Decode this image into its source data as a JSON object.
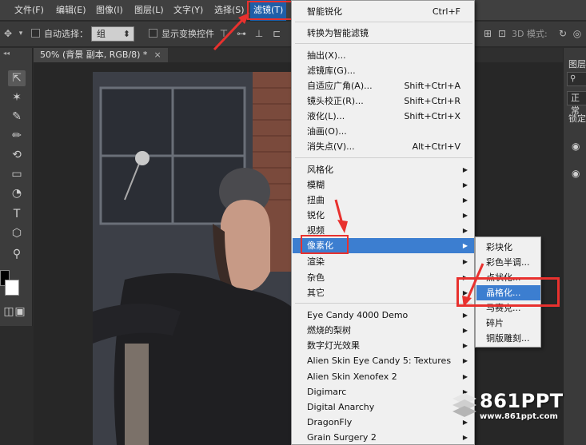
{
  "menubar": {
    "items": [
      "文件(F)",
      "编辑(E)",
      "图像(I)",
      "图层(L)",
      "文字(Y)",
      "选择(S)",
      "滤镜(T)"
    ]
  },
  "optionsbar": {
    "auto_select_label": "自动选择：",
    "group_value": "组",
    "show_transform_label": "显示变换控件",
    "mode_3d_label": "3D 模式:"
  },
  "document": {
    "tab_label": "50% (背景 副本, RGB/8) *",
    "close_glyph": "×"
  },
  "right_panel": {
    "layers_tab": "图层",
    "blend_mode": "正常",
    "lock_label": "锁定"
  },
  "filter_menu": {
    "smart_sharpen": {
      "label": "智能锐化",
      "shortcut": "Ctrl+F"
    },
    "convert_smart": {
      "label": "转换为智能滤镜"
    },
    "extract": {
      "label": "抽出(X)..."
    },
    "gallery": {
      "label": "滤镜库(G)..."
    },
    "adaptive_wide": {
      "label": "自适应广角(A)...",
      "shortcut": "Shift+Ctrl+A"
    },
    "lens_correction": {
      "label": "镜头校正(R)...",
      "shortcut": "Shift+Ctrl+R"
    },
    "liquify": {
      "label": "液化(L)...",
      "shortcut": "Shift+Ctrl+X"
    },
    "oil_paint": {
      "label": "油画(O)..."
    },
    "vanishing_point": {
      "label": "消失点(V)...",
      "shortcut": "Alt+Ctrl+V"
    },
    "stylize": {
      "label": "风格化"
    },
    "blur": {
      "label": "模糊"
    },
    "distort": {
      "label": "扭曲"
    },
    "sharpen": {
      "label": "锐化"
    },
    "video": {
      "label": "视频"
    },
    "pixelate": {
      "label": "像素化"
    },
    "render": {
      "label": "渲染"
    },
    "noise": {
      "label": "杂色"
    },
    "other": {
      "label": "其它"
    },
    "eye_candy": {
      "label": "Eye Candy 4000 Demo"
    },
    "burn_pear": {
      "label": "燃烧的梨树"
    },
    "digital_light": {
      "label": "数字灯光效果"
    },
    "alien_textures": {
      "label": "Alien Skin Eye Candy 5: Textures"
    },
    "alien_xenofex": {
      "label": "Alien Skin Xenofex 2"
    },
    "digimarc": {
      "label": "Digimarc"
    },
    "digital_anarchy": {
      "label": "Digital Anarchy"
    },
    "dragonfly": {
      "label": "DragonFly"
    },
    "grain_surgery": {
      "label": "Grain Surgery 2"
    },
    "submenu_arrow": "▶"
  },
  "pixelate_submenu": {
    "items": [
      "彩块化",
      "彩色半调...",
      "点状化...",
      "晶格化...",
      "马赛克...",
      "碎片",
      "铜版雕刻..."
    ]
  },
  "watermark": {
    "logo": "861PPT",
    "url": "www.861ppt.com"
  },
  "colors": {
    "menu_highlight": "#3c7ed0",
    "annotation_red": "#e8312e",
    "menubar_active": "#1f5ea8"
  }
}
